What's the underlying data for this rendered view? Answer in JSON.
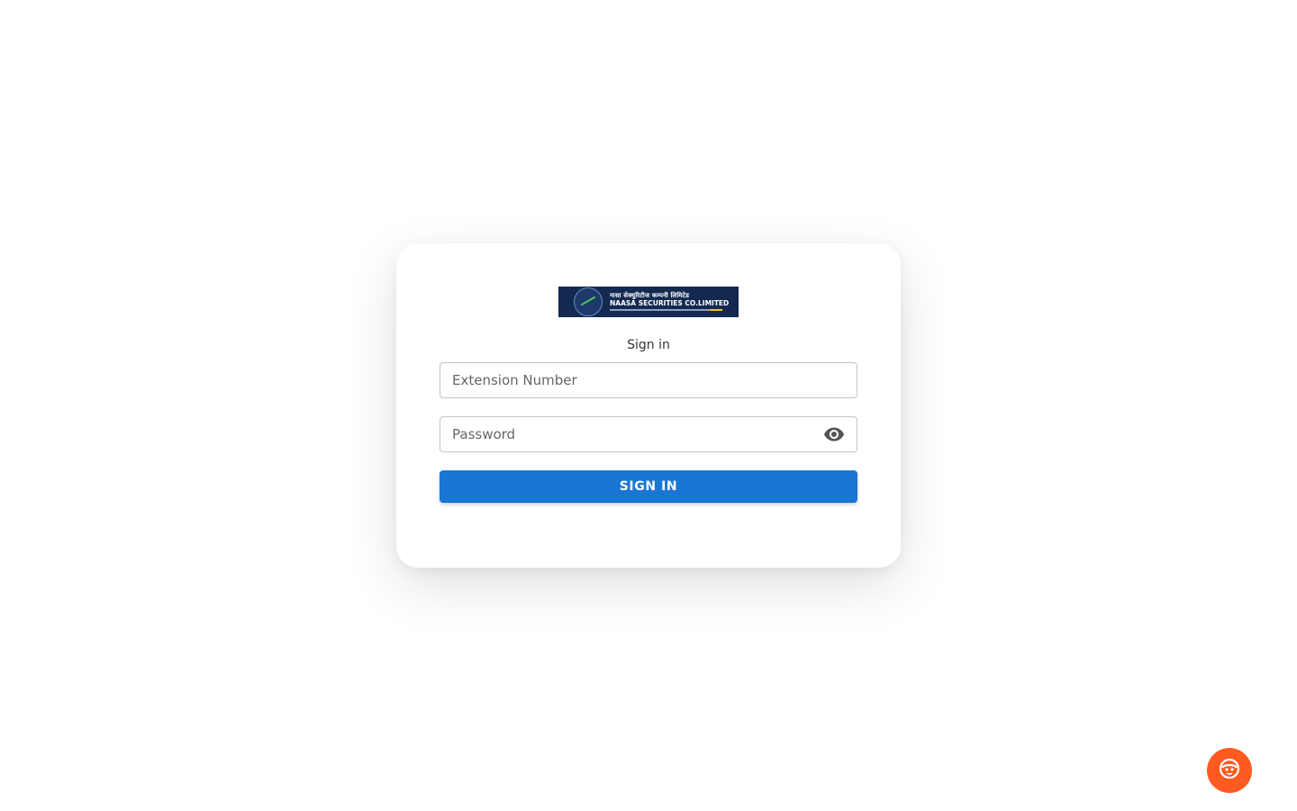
{
  "logo": {
    "line1": "नासा सेक्युरिटीज कम्पनी लिमिटेड",
    "line2": "NAASA SECURITIES CO.LIMITED"
  },
  "form": {
    "title": "Sign in",
    "extension": {
      "placeholder": "Extension Number",
      "value": ""
    },
    "password": {
      "placeholder": "Password",
      "value": ""
    },
    "submit_label": "SIGN IN"
  },
  "icons": {
    "password_toggle": "eye-icon",
    "chat": "chat-bot-icon"
  },
  "colors": {
    "primary": "#1976d2",
    "chat_accent": "#ff5a1f",
    "logo_bg": "#13294f"
  }
}
